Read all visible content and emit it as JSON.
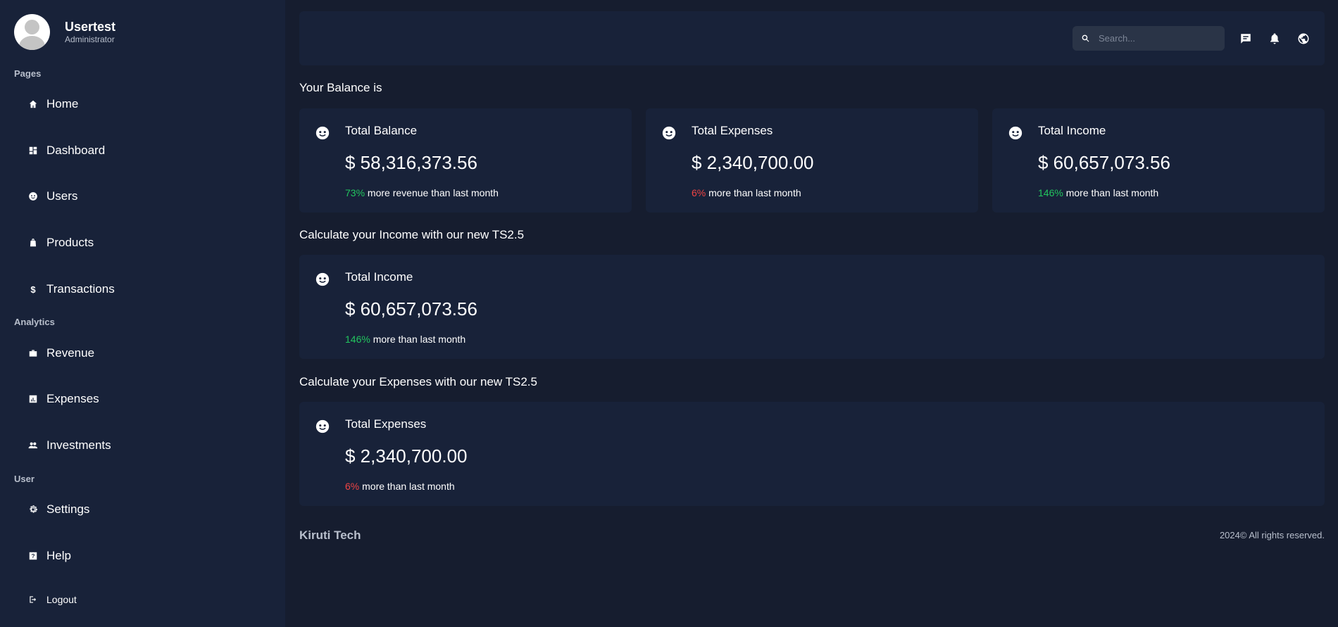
{
  "profile": {
    "name": "Usertest",
    "role": "Administrator"
  },
  "sidebar": {
    "sections": {
      "pages": "Pages",
      "analytics": "Analytics",
      "user": "User"
    },
    "items": {
      "home": {
        "label": "Home",
        "icon": "home-icon"
      },
      "dashboard": {
        "label": "Dashboard",
        "icon": "dashboard-icon"
      },
      "users": {
        "label": "Users",
        "icon": "face-icon"
      },
      "products": {
        "label": "Products",
        "icon": "bag-icon"
      },
      "transactions": {
        "label": "Transactions",
        "icon": "dollar-icon"
      },
      "revenue": {
        "label": "Revenue",
        "icon": "briefcase-icon"
      },
      "expenses": {
        "label": "Expenses",
        "icon": "chart-icon"
      },
      "investments": {
        "label": "Investments",
        "icon": "people-icon"
      },
      "settings": {
        "label": "Settings",
        "icon": "gear-icon"
      },
      "help": {
        "label": "Help",
        "icon": "help-icon"
      },
      "logout": {
        "label": "Logout",
        "icon": "logout-icon"
      }
    }
  },
  "header": {
    "search_placeholder": "Search..."
  },
  "main": {
    "balance_heading": "Your Balance is",
    "income_heading": "Calculate your Income with our new TS2.5",
    "expenses_heading": "Calculate your Expenses with our new TS2.5",
    "cards": {
      "balance": {
        "title": "Total Balance",
        "value": "$ 58,316,373.56",
        "pct": "73%",
        "note": " more revenue than last month"
      },
      "expenses": {
        "title": "Total Expenses",
        "value": "$ 2,340,700.00",
        "pct": "6%",
        "note": " more than last month"
      },
      "income": {
        "title": "Total Income",
        "value": "$ 60,657,073.56",
        "pct": "146%",
        "note": " more than last month"
      },
      "income_wide": {
        "title": "Total Income",
        "value": "$ 60,657,073.56",
        "pct": "146%",
        "note": " more than last month"
      },
      "expenses_wide": {
        "title": "Total Expenses",
        "value": "$ 2,340,700.00",
        "pct": "6%",
        "note": " more than last month"
      }
    }
  },
  "footer": {
    "brand": "Kiruti Tech",
    "copyright": "2024© All rights reserved."
  },
  "colors": {
    "background": "#161d2f",
    "panel": "#182239",
    "positive": "#22c55e",
    "negative": "#ef4444"
  }
}
